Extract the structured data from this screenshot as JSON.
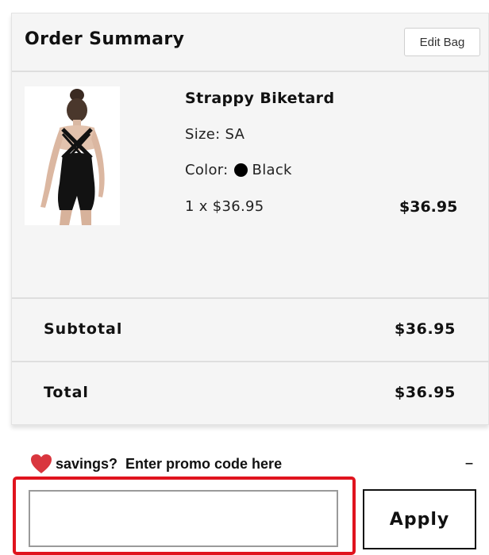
{
  "order_summary": {
    "title": "Order Summary",
    "edit_bag_label": "Edit Bag"
  },
  "product": {
    "name": "Strappy Biketard",
    "size": "Size: SA",
    "color_label": "Color:",
    "color_name": "Black",
    "color_hex": "#000000",
    "quantity_price": "1 x $36.95",
    "line_total": "$36.95",
    "image_icon": "product-photo-dancer-black-biketard"
  },
  "totals": {
    "subtotal_label": "Subtotal",
    "subtotal_value": "$36.95",
    "total_label": "Total",
    "total_value": "$36.95"
  },
  "promo": {
    "heart_icon": "heart-icon",
    "heart_color": "#d9363e",
    "text": "savings?  Enter promo code here",
    "collapse_symbol": "–",
    "input_value": "",
    "input_placeholder": "",
    "apply_label": "Apply",
    "highlight_color": "#e0141e"
  }
}
